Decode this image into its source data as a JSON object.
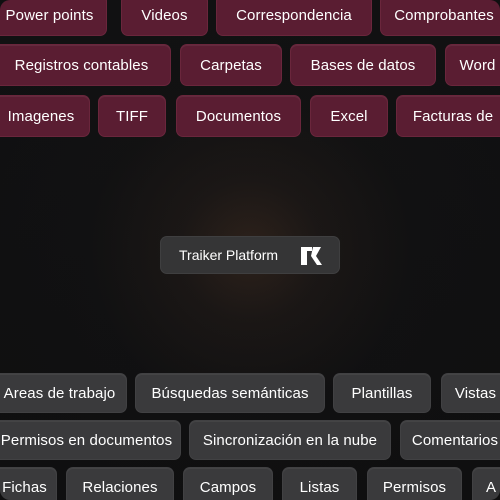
{
  "center": {
    "title": "Traiker Platform",
    "logo_icon": "traiker-logo-icon"
  },
  "top_rows": [
    [
      "Power points",
      "Videos",
      "Correspondencia",
      "Comprobantes"
    ],
    [
      "Registros  contables",
      "Carpetas",
      "Bases de datos",
      "Word"
    ],
    [
      "Imagenes",
      "TIFF",
      "Documentos",
      "Excel",
      "Facturas de"
    ]
  ],
  "bottom_rows": [
    [
      "Areas de trabajo",
      "Búsquedas semánticas",
      "Plantillas",
      "Vistas"
    ],
    [
      "Permisos en documentos",
      "Sincronización en la nube",
      "Comentarios"
    ],
    [
      "Fichas",
      "Relaciones",
      "Campos",
      "Listas",
      "Permisos",
      "A"
    ]
  ],
  "colors": {
    "top_chip": "#5a1d32",
    "bottom_chip": "#3a3a3c",
    "background": "#0f0f10",
    "text": "#ffffff"
  }
}
